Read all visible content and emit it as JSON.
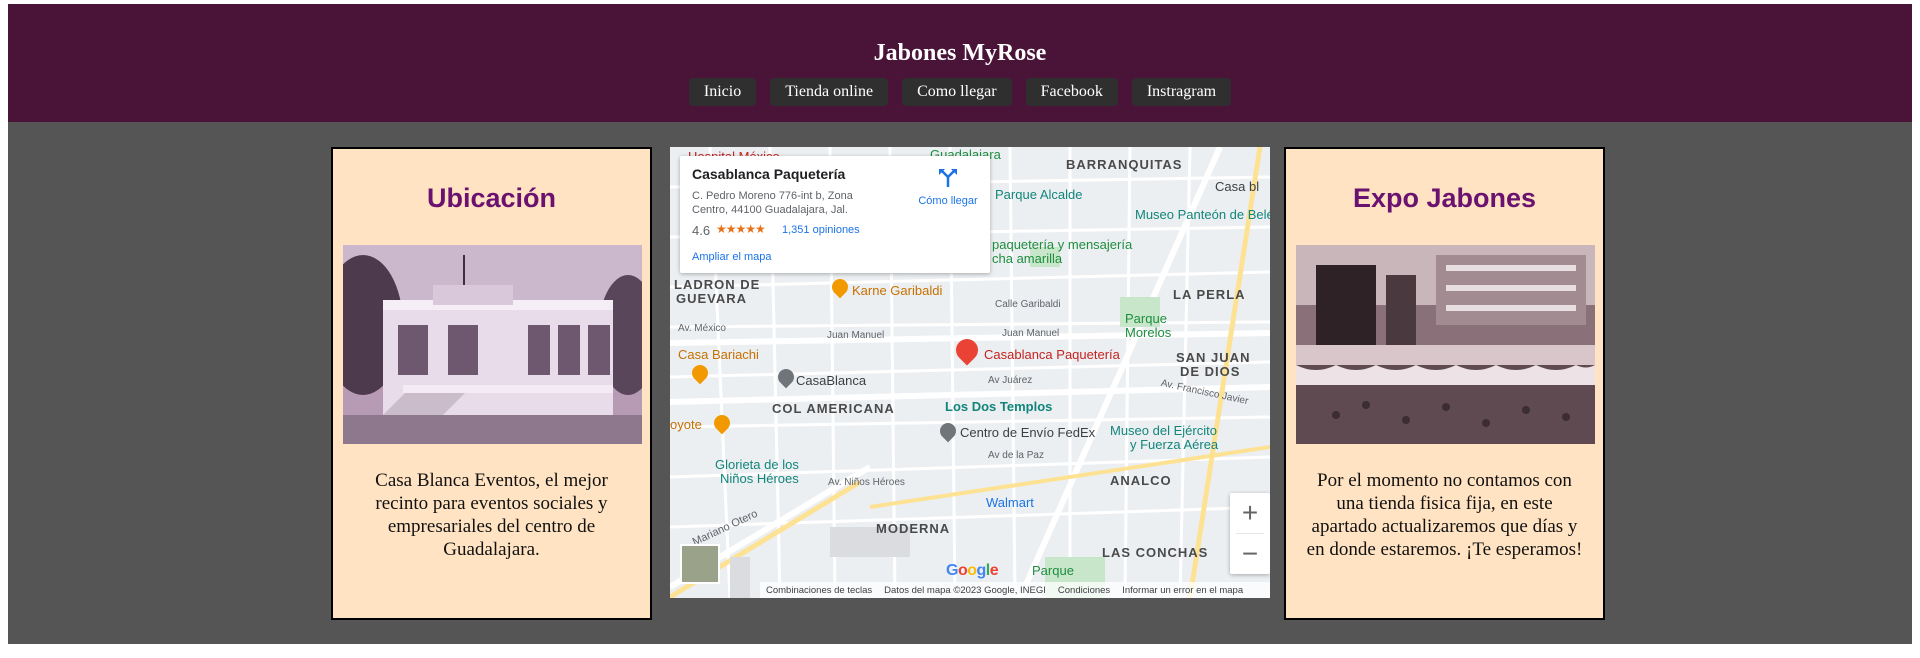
{
  "site": {
    "title": "Jabones MyRose",
    "nav": [
      "Inicio",
      "Tienda online",
      "Como llegar",
      "Facebook",
      "Instragram"
    ]
  },
  "colors": {
    "header_bg": "#4a1438",
    "page_bg": "#555555",
    "card_bg": "#ffe3c2",
    "card_title": "#6b1270",
    "nav_btn": "#2f2f2f"
  },
  "location_card": {
    "title": "Ubicación",
    "text": "Casa Blanca Eventos, el mejor recinto para eventos sociales y empresariales del centro de Guadalajara."
  },
  "expo_card": {
    "title": "Expo Jabones",
    "text": "Por el momento no contamos con una tienda fisica fija, en este apartado actualizaremos que días y en donde estaremos. ¡Te esperamos!"
  },
  "map": {
    "place": {
      "name": "Casablanca Paquetería",
      "address": "C. Pedro Moreno 776-int b, Zona Centro, 44100 Guadalajara, Jal.",
      "rating": "4.6",
      "stars": "★★★★★",
      "reviews": "1,351 opiniones",
      "directions": "Cómo llegar",
      "enlarge": "Ampliar el mapa"
    },
    "labels": {
      "hospital": "Hospital México",
      "guadalajara": "Guadalajara",
      "barranquitas": "BARRANQUITAS",
      "casa_bl": "Casa bl",
      "parque_alcalde": "Parque Alcalde",
      "museo_panteon": "Museo Panteón de Belén",
      "paqueteria_mensajeria": "paquetería y mensajería",
      "cha_amarilla": "cha amarilla",
      "ladron": "LADRON DE",
      "guevara": "GUEVARA",
      "karne": "Karne Garibaldi",
      "calle_garibaldi": "Calle Garibaldi",
      "la_perla": "LA PERLA",
      "av_mexico": "Av. México",
      "juan_manuel_1": "Juan Manuel",
      "juan_manuel_2": "Juan Manuel",
      "parque_morelos_1": "Parque",
      "parque_morelos_2": "Morelos",
      "casa_bariachi": "Casa Bariachi",
      "casablanca_pin": "Casablanca Paquetería",
      "san_juan_1": "SAN JUAN",
      "san_juan_2": "DE DIOS",
      "casablanca_grey": "CasaBlanca",
      "av_juarez": "Av Juárez",
      "av_francisco": "Av. Francisco Javier",
      "col_americana": "COL AMERICANA",
      "los_dos_templos": "Los Dos Templos",
      "coyote": "oyote",
      "fedex": "Centro de Envío FedEx",
      "museo_ejercito_1": "Museo del Ejército",
      "museo_ejercito_2": "y Fuerza Aérea",
      "av_de_la_paz": "Av de la Paz",
      "glorieta_1": "Glorieta de los",
      "glorieta_2": "Niños Héroes",
      "av_ninos": "Av. Niños Héroes",
      "analco": "ANALCO",
      "walmart": "Walmart",
      "mariano_otero": "Mariano Otero",
      "moderna": "MODERNA",
      "las_conchas": "LAS CONCHAS",
      "parque": "Parque"
    },
    "footer": [
      "Combinaciones de teclas",
      "Datos del mapa ©2023 Google, INEGI",
      "Condiciones",
      "Informar un error en el mapa"
    ],
    "zoom_in": "+",
    "zoom_out": "−",
    "google": [
      "G",
      "o",
      "o",
      "g",
      "l",
      "e"
    ]
  }
}
